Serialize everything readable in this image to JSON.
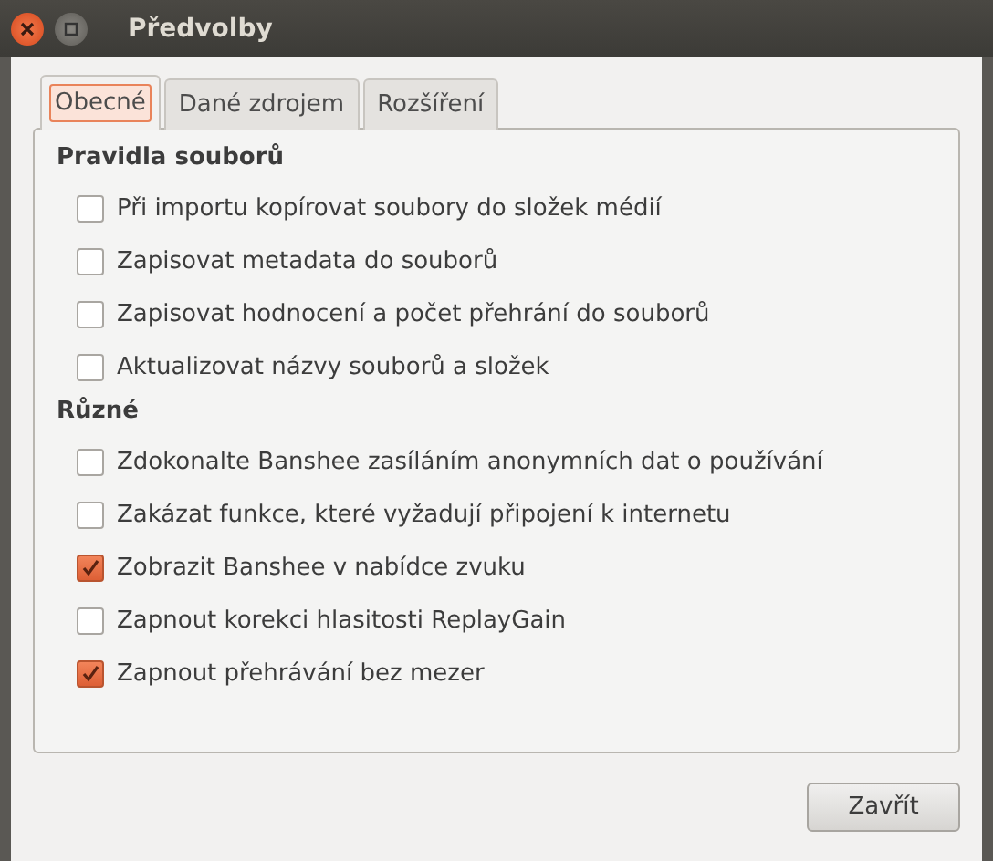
{
  "window": {
    "title": "Předvolby"
  },
  "tabs": [
    {
      "label": "Obecné",
      "selected": true
    },
    {
      "label": "Dané zdrojem",
      "selected": false
    },
    {
      "label": "Rozšíření",
      "selected": false
    }
  ],
  "sections": [
    {
      "heading": "Pravidla souborů",
      "options": [
        {
          "label": "Při importu kopírovat soubory do složek médií",
          "checked": false
        },
        {
          "label": "Zapisovat metadata do souborů",
          "checked": false
        },
        {
          "label": "Zapisovat hodnocení a počet přehrání do souborů",
          "checked": false
        },
        {
          "label": "Aktualizovat názvy souborů a složek",
          "checked": false
        }
      ]
    },
    {
      "heading": "Různé",
      "options": [
        {
          "label": "Zdokonalte Banshee zasíláním anonymních dat o používání",
          "checked": false
        },
        {
          "label": "Zakázat funkce, které vyžadují připojení k internetu",
          "checked": false
        },
        {
          "label": "Zobrazit Banshee v nabídce zvuku",
          "checked": true
        },
        {
          "label": "Zapnout korekci hlasitosti ReplayGain",
          "checked": false
        },
        {
          "label": "Zapnout přehrávání bez mezer",
          "checked": true
        }
      ]
    }
  ],
  "buttons": [
    "Zavřít"
  ]
}
